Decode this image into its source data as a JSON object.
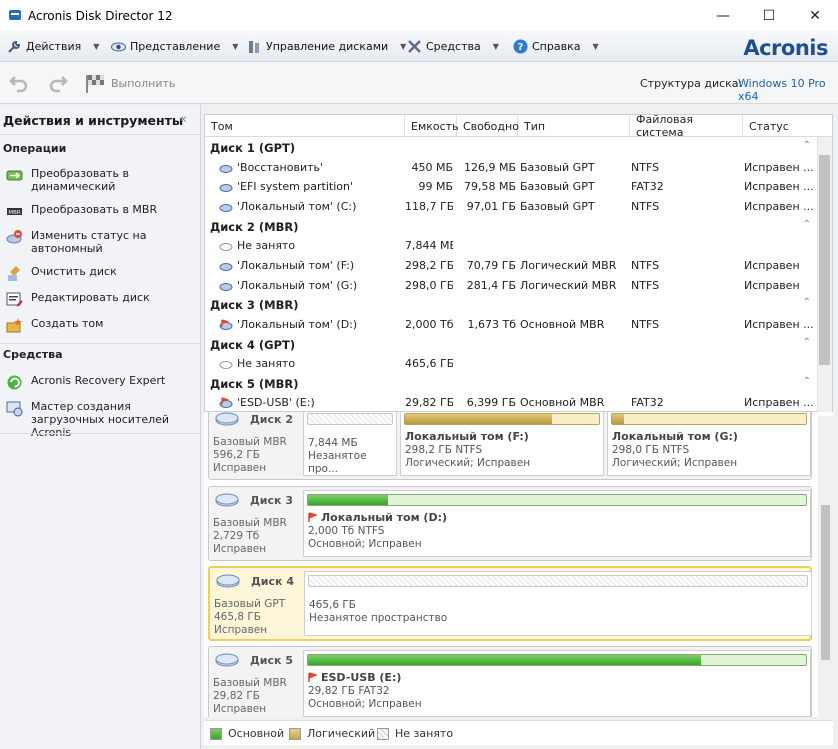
{
  "window": {
    "title": "Acronis Disk Director 12",
    "minimize": "—",
    "maximize": "☐",
    "close": "✕"
  },
  "menu": [
    {
      "label": "Действия",
      "icon": "wrench-icon"
    },
    {
      "label": "Представление",
      "icon": "eye-icon"
    },
    {
      "label": "Управление дисками",
      "icon": "disk-manage-icon"
    },
    {
      "label": "Средства",
      "icon": "tools-icon"
    },
    {
      "label": "Справка",
      "icon": "help-icon"
    }
  ],
  "brand": "Acronis",
  "toolbar": {
    "undo_icon": "undo-icon",
    "redo_icon": "redo-icon",
    "execute_label": "Выполнить",
    "structure_label": "Структура диска:",
    "structure_value": "Windows 10 Pro x64"
  },
  "sidebar": {
    "title": "Действия и инструменты",
    "collapse": "«",
    "operations_title": "Операции",
    "operations": [
      {
        "label": "Преобразовать в динамический",
        "icon": "convert-dynamic-icon"
      },
      {
        "label": "Преобразовать в MBR",
        "icon": "convert-mbr-icon"
      },
      {
        "label": "Изменить статус на автономный",
        "icon": "offline-status-icon"
      },
      {
        "label": "Очистить диск",
        "icon": "clean-disk-icon"
      },
      {
        "label": "Редактировать диск",
        "icon": "edit-disk-icon"
      },
      {
        "label": "Создать том",
        "icon": "create-volume-icon"
      }
    ],
    "tools_title": "Средства",
    "tools": [
      {
        "label": "Acronis Recovery Expert",
        "icon": "recovery-expert-icon"
      },
      {
        "label": "Мастер создания загрузочных носителей Acronis",
        "icon": "bootable-media-icon"
      }
    ]
  },
  "table": {
    "columns": [
      "Том",
      "Емкость",
      "Свободно",
      "Тип",
      "Файловая система",
      "Статус"
    ],
    "rows": [
      {
        "kind": "group",
        "name": "Диск 1 (GPT)"
      },
      {
        "kind": "vol",
        "icon": "volume-icon",
        "name": "'Восстановить'",
        "cap": "450 МБ",
        "free": "126,9 МБ",
        "type": "Базовый GPT",
        "fs": "NTFS",
        "status": "Исправен ..."
      },
      {
        "kind": "vol",
        "icon": "volume-icon",
        "name": "'EFI system partition'",
        "cap": "99 МБ",
        "free": "79,58 МБ",
        "type": "Базовый GPT",
        "fs": "FAT32",
        "status": "Исправен ..."
      },
      {
        "kind": "vol",
        "icon": "volume-icon",
        "name": "'Локальный том' (C:)",
        "cap": "118,7 ГБ",
        "free": "97,01 ГБ",
        "type": "Базовый GPT",
        "fs": "NTFS",
        "status": "Исправен ..."
      },
      {
        "kind": "group",
        "name": "Диск 2 (MBR)"
      },
      {
        "kind": "vol",
        "icon": "unallocated-icon",
        "name": "Не занято",
        "cap": "7,844 МБ",
        "free": "",
        "type": "",
        "fs": "",
        "status": ""
      },
      {
        "kind": "vol",
        "icon": "volume-icon",
        "name": "'Локальный том' (F:)",
        "cap": "298,2 ГБ",
        "free": "70,79 ГБ",
        "type": "Логический MBR",
        "fs": "NTFS",
        "status": "Исправен"
      },
      {
        "kind": "vol",
        "icon": "volume-icon",
        "name": "'Локальный том' (G:)",
        "cap": "298,0 ГБ",
        "free": "281,4 ГБ",
        "type": "Логический MBR",
        "fs": "NTFS",
        "status": "Исправен"
      },
      {
        "kind": "group",
        "name": "Диск 3 (MBR)"
      },
      {
        "kind": "vol",
        "icon": "active-volume-icon",
        "name": "'Локальный том' (D:)",
        "cap": "2,000 Тб",
        "free": "1,673 Тб",
        "type": "Основной MBR",
        "fs": "NTFS",
        "status": "Исправен ..."
      },
      {
        "kind": "group",
        "name": "Диск 4 (GPT)"
      },
      {
        "kind": "vol",
        "icon": "unallocated-icon",
        "name": "Не занято",
        "cap": "465,6 ГБ",
        "free": "",
        "type": "",
        "fs": "",
        "status": ""
      },
      {
        "kind": "group",
        "name": "Диск 5 (MBR)"
      },
      {
        "kind": "vol",
        "icon": "active-volume-icon",
        "name": "'ESD-USB' (E:)",
        "cap": "29,82 ГБ",
        "free": "6,399 ГБ",
        "type": "Основной MBR",
        "fs": "FAT32",
        "status": "Исправен ..."
      }
    ]
  },
  "disks": [
    {
      "name": "Диск 2",
      "meta": [
        "Базовый MBR",
        "596,2 ГБ",
        "Исправен"
      ],
      "parts": [
        {
          "kind": "free",
          "name": "",
          "meta": [
            "7,844 МБ",
            "Незанятое про..."
          ],
          "used": 0
        },
        {
          "kind": "log",
          "name": "Локальный том (F:)",
          "meta": [
            "298,2 ГБ NTFS",
            "Логический; Исправен"
          ],
          "used": 0.76
        },
        {
          "kind": "log",
          "name": "Локальный том (G:)",
          "meta": [
            "298,0 ГБ NTFS",
            "Логический; Исправен"
          ],
          "used": 0.06
        }
      ]
    },
    {
      "name": "Диск 3",
      "meta": [
        "Базовый MBR",
        "2,729 Тб",
        "Исправен"
      ],
      "parts": [
        {
          "kind": "pri",
          "name": "Локальный том (D:)",
          "flag": true,
          "meta": [
            "2,000 Тб NTFS",
            "Основной; Исправен"
          ],
          "used": 0.16
        }
      ]
    },
    {
      "name": "Диск 4",
      "selected": true,
      "meta": [
        "Базовый GPT",
        "465,8 ГБ",
        "Исправен"
      ],
      "parts": [
        {
          "kind": "free",
          "name": "",
          "meta": [
            "465,6 ГБ",
            "Незанятое пространство"
          ],
          "used": 0
        }
      ]
    },
    {
      "name": "Диск 5",
      "meta": [
        "Базовый MBR",
        "29,82 ГБ",
        "Исправен"
      ],
      "parts": [
        {
          "kind": "pri",
          "name": "ESD-USB (E:)",
          "flag": true,
          "meta": [
            "29,82 ГБ FAT32",
            "Основной; Исправен"
          ],
          "used": 0.79
        }
      ]
    }
  ],
  "legend": [
    "Основной",
    "Логический",
    "Не занято"
  ],
  "colors": {
    "accent": "#1a62b5",
    "primary": "#4fb83e",
    "logical": "#cfb25a",
    "selected_border": "#efcf5c"
  }
}
